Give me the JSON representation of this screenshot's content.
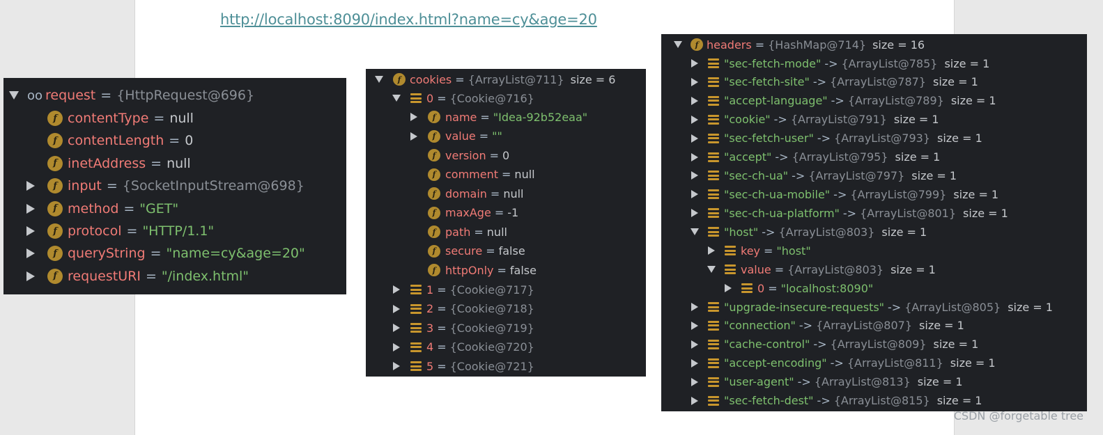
{
  "url": "http://localhost:8090/index.html?name=cy&age=20",
  "watermark": "CSDN @forgetable tree",
  "request_panel": {
    "root": {
      "name": "request",
      "eq": "=",
      "ref": "{HttpRequest@696}"
    },
    "fields": [
      {
        "name": "contentType",
        "eq": "=",
        "value": "null"
      },
      {
        "name": "contentLength",
        "eq": "=",
        "value": "0"
      },
      {
        "name": "inetAddress",
        "eq": "=",
        "value": "null"
      },
      {
        "name": "input",
        "eq": "=",
        "value": "{SocketInputStream@698}"
      },
      {
        "name": "method",
        "eq": "=",
        "value": "\"GET\""
      },
      {
        "name": "protocol",
        "eq": "=",
        "value": "\"HTTP/1.1\""
      },
      {
        "name": "queryString",
        "eq": "=",
        "value": "\"name=cy&age=20\""
      },
      {
        "name": "requestURI",
        "eq": "=",
        "value": "\"/index.html\""
      }
    ]
  },
  "cookies_panel": {
    "root": {
      "name": "cookies",
      "eq": "=",
      "ref": "{ArrayList@711}",
      "size": "size = 6"
    },
    "item0": {
      "name": "0",
      "eq": "=",
      "ref": "{Cookie@716}"
    },
    "fields": [
      {
        "name": "name",
        "eq": "=",
        "value": "\"Idea-92b52eaa\""
      },
      {
        "name": "value",
        "eq": "=",
        "value": "\"\""
      },
      {
        "name": "version",
        "eq": "=",
        "value": "0"
      },
      {
        "name": "comment",
        "eq": "=",
        "value": "null"
      },
      {
        "name": "domain",
        "eq": "=",
        "value": "null"
      },
      {
        "name": "maxAge",
        "eq": "=",
        "value": "-1"
      },
      {
        "name": "path",
        "eq": "=",
        "value": "null"
      },
      {
        "name": "secure",
        "eq": "=",
        "value": "false"
      },
      {
        "name": "httpOnly",
        "eq": "=",
        "value": "false"
      }
    ],
    "items": [
      {
        "name": "1",
        "eq": "=",
        "ref": "{Cookie@717}"
      },
      {
        "name": "2",
        "eq": "=",
        "ref": "{Cookie@718}"
      },
      {
        "name": "3",
        "eq": "=",
        "ref": "{Cookie@719}"
      },
      {
        "name": "4",
        "eq": "=",
        "ref": "{Cookie@720}"
      },
      {
        "name": "5",
        "eq": "=",
        "ref": "{Cookie@721}"
      }
    ]
  },
  "headers_panel": {
    "root": {
      "name": "headers",
      "eq": "=",
      "ref": "{HashMap@714}",
      "size": "size = 16"
    },
    "entries_a": [
      {
        "key": "\"sec-fetch-mode\"",
        "arrow": "->",
        "ref": "{ArrayList@785}",
        "size": "size = 1"
      },
      {
        "key": "\"sec-fetch-site\"",
        "arrow": "->",
        "ref": "{ArrayList@787}",
        "size": "size = 1"
      },
      {
        "key": "\"accept-language\"",
        "arrow": "->",
        "ref": "{ArrayList@789}",
        "size": "size = 1"
      },
      {
        "key": "\"cookie\"",
        "arrow": "->",
        "ref": "{ArrayList@791}",
        "size": "size = 1"
      },
      {
        "key": "\"sec-fetch-user\"",
        "arrow": "->",
        "ref": "{ArrayList@793}",
        "size": "size = 1"
      },
      {
        "key": "\"accept\"",
        "arrow": "->",
        "ref": "{ArrayList@795}",
        "size": "size = 1"
      },
      {
        "key": "\"sec-ch-ua\"",
        "arrow": "->",
        "ref": "{ArrayList@797}",
        "size": "size = 1"
      },
      {
        "key": "\"sec-ch-ua-mobile\"",
        "arrow": "->",
        "ref": "{ArrayList@799}",
        "size": "size = 1"
      },
      {
        "key": "\"sec-ch-ua-platform\"",
        "arrow": "->",
        "ref": "{ArrayList@801}",
        "size": "size = 1"
      }
    ],
    "host": {
      "key": "\"host\"",
      "arrow": "->",
      "ref": "{ArrayList@803}",
      "size": "size = 1"
    },
    "host_key": {
      "name": "key",
      "eq": "=",
      "value": "\"host\""
    },
    "host_value": {
      "name": "value",
      "eq": "=",
      "ref": "{ArrayList@803}",
      "size": "size = 1"
    },
    "host_value_0": {
      "name": "0",
      "eq": "=",
      "value": "\"localhost:8090\""
    },
    "entries_b": [
      {
        "key": "\"upgrade-insecure-requests\"",
        "arrow": "->",
        "ref": "{ArrayList@805}",
        "size": "size = 1"
      },
      {
        "key": "\"connection\"",
        "arrow": "->",
        "ref": "{ArrayList@807}",
        "size": "size = 1"
      },
      {
        "key": "\"cache-control\"",
        "arrow": "->",
        "ref": "{ArrayList@809}",
        "size": "size = 1"
      },
      {
        "key": "\"accept-encoding\"",
        "arrow": "->",
        "ref": "{ArrayList@811}",
        "size": "size = 1"
      },
      {
        "key": "\"user-agent\"",
        "arrow": "->",
        "ref": "{ArrayList@813}",
        "size": "size = 1"
      },
      {
        "key": "\"sec-fetch-dest\"",
        "arrow": "->",
        "ref": "{ArrayList@815}",
        "size": "size = 1"
      }
    ]
  },
  "icons": {
    "field": "f-field-icon",
    "list": "list-element-icon",
    "watch": "glasses-watch-icon",
    "expand": "expand-arrow-icon",
    "collapse": "collapse-arrow-icon"
  },
  "colors": {
    "panel_bg": "#1f2125",
    "name": "#f07b76",
    "string": "#7ec06e",
    "ref": "#8a8f96",
    "field_icon": "#b08a2e",
    "list_icon": "#c8962d",
    "link": "#4e8f97"
  }
}
